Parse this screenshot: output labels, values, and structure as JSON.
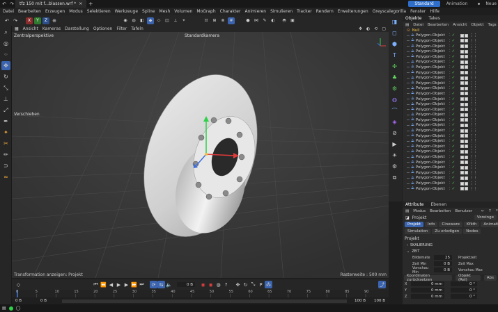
{
  "titlebar": {
    "doc_tab": "tfz 150 mit f...blassen.wrf *",
    "new_tab": "+",
    "layouts": [
      "Standard",
      "Animation"
    ],
    "new_label": "Neue"
  },
  "menubar": [
    "Datei",
    "Bearbeiten",
    "Erzeugen",
    "Modus",
    "Selektieren",
    "Werkzeuge",
    "Spline",
    "Mesh",
    "Volumen",
    "MoGraph",
    "Charakter",
    "Animieren",
    "Simulieren",
    "Tracker",
    "Rendern",
    "Erweiterungen",
    "Greyscalegorilla",
    "Fenster",
    "Hilfe"
  ],
  "axis_lock": [
    "X",
    "Y",
    "Z"
  ],
  "viewport": {
    "menu": [
      "Ansicht",
      "Kameras",
      "Darstellung",
      "Optionen",
      "Filter",
      "Tafeln"
    ],
    "projection": "Zentralperspektive",
    "camera": "Standardkamera",
    "tool_label": "Verschieben",
    "status_left": "Transformation anzeigen: Projekt",
    "status_right": "Rasterweite : 500 mm",
    "colors": {
      "bg": "#3a3a3a",
      "disc": "#d8d8d8",
      "grid": "#474747"
    }
  },
  "timeline": {
    "current_frame": "0 B",
    "ruler_ticks": [
      "0",
      "5",
      "10",
      "15",
      "20",
      "25",
      "30",
      "35",
      "40",
      "45",
      "50",
      "55",
      "60",
      "65",
      "70",
      "75",
      "80",
      "85",
      "90"
    ],
    "start_field": "0 B",
    "start_field2": "0 B",
    "end_field": "100 B",
    "end_field2": "100 B"
  },
  "objects": {
    "tabs": [
      "Objekte",
      "Takes"
    ],
    "menu": [
      "Datei",
      "Bearbeiten",
      "Ansicht",
      "Objekt",
      "Tags"
    ],
    "null_name": "Null",
    "items": [
      "Polygon-Objekt",
      "Polygon-Objekt",
      "Polygon-Objekt",
      "Polygon-Objekt",
      "Polygon-Objekt",
      "Polygon-Objekt",
      "Polygon-Objekt",
      "Polygon-Objekt",
      "Polygon-Objekt",
      "Polygon-Objekt",
      "Polygon-Objekt",
      "Polygon-Objekt",
      "Polygon-Objekt",
      "Polygon-Objekt",
      "Polygon-Objekt",
      "Polygon-Objekt",
      "Polygon-Objekt",
      "Polygon-Objekt",
      "Polygon-Objekt",
      "Polygon-Objekt",
      "Polygon-Objekt",
      "Polygon-Objekt",
      "Polygon-Objekt",
      "Polygon-Objekt",
      "Polygon-Objekt",
      "Polygon-Objekt",
      "Polygon-Objekt",
      "Polygon-Objekt",
      "Polygon-Objekt",
      "Polygon-Objekt"
    ]
  },
  "attributes": {
    "tabs": [
      "Attribute",
      "Ebenen"
    ],
    "menu": [
      "Modus",
      "Bearbeiten",
      "Benutzer"
    ],
    "title": "Projekt",
    "voreinst": "Voreinge",
    "subtabs": [
      "Projekt",
      "Info",
      "Cineware",
      "Kfkth",
      "Animation"
    ],
    "subtabs2": [
      "Simulation",
      "Zu erledigen",
      "Nodes"
    ],
    "section": "Projekt",
    "groups": [
      "SKALIERUNG",
      "ZEIT"
    ],
    "fields": [
      {
        "label": "Bildemate",
        "value": "25",
        "label2": "Projektzeit"
      },
      {
        "label": "Zeit Min",
        "value": "0 B",
        "label2": "Zeit Max"
      },
      {
        "label": "Vorschau Min",
        "value": "0 B",
        "label2": "Vorschau Max"
      }
    ]
  },
  "coords": {
    "reset_label": "Koordinaten zurücksetzen",
    "mode": "Objekt (Rel)",
    "abs": "Abs",
    "rows": [
      {
        "axis": "X",
        "pos": "0 mm",
        "rot": "0 °"
      },
      {
        "axis": "Y",
        "pos": "0 mm",
        "rot": "0 °"
      },
      {
        "axis": "Z",
        "pos": "0 mm",
        "rot": "0 °"
      }
    ]
  }
}
